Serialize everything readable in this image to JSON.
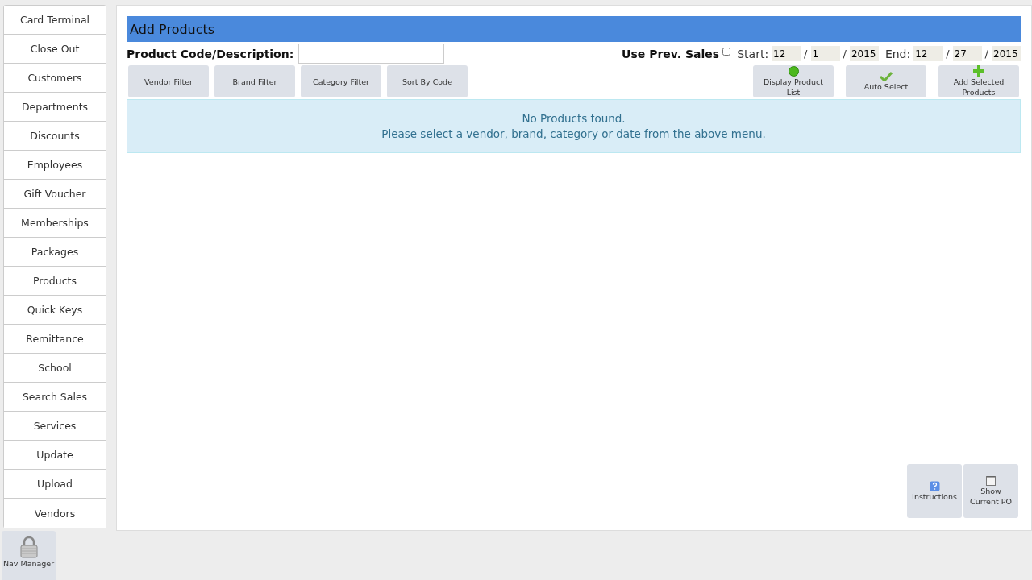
{
  "sidebar": {
    "items": [
      {
        "label": "Card Terminal",
        "selected": false
      },
      {
        "label": "Close Out",
        "selected": false
      },
      {
        "label": "Customers",
        "selected": false
      },
      {
        "label": "Departments",
        "selected": false
      },
      {
        "label": "Discounts",
        "selected": false
      },
      {
        "label": "Employees",
        "selected": false
      },
      {
        "label": "Gift Voucher",
        "selected": false
      },
      {
        "label": "Memberships",
        "selected": false
      },
      {
        "label": "Packages",
        "selected": false
      },
      {
        "label": "Products",
        "selected": false
      },
      {
        "label": "Quick Keys",
        "selected": false
      },
      {
        "label": "Remittance",
        "selected": false
      },
      {
        "label": "School",
        "selected": false
      },
      {
        "label": "Search Sales",
        "selected": false
      },
      {
        "label": "Services",
        "selected": false
      },
      {
        "label": "Update",
        "selected": false
      },
      {
        "label": "Upload",
        "selected": false
      },
      {
        "label": "Vendors",
        "selected": false
      }
    ]
  },
  "nav_manager": {
    "label": "Nav Manager",
    "kind": "lock"
  },
  "panel": {
    "title": "Add Products",
    "search": {
      "label": "Product Code/Description:"
    },
    "prev_sales": {
      "label": "Use Prev. Sales",
      "checked": false
    },
    "start": {
      "label": "Start:",
      "fields": [
        "12",
        "1",
        "2015"
      ]
    },
    "end": {
      "label": "End:",
      "fields": [
        "12",
        "27",
        "2015"
      ]
    },
    "separator": "/",
    "filters": [
      {
        "label": "Vendor Filter"
      },
      {
        "label": "Brand Filter"
      },
      {
        "label": "Category Filter"
      },
      {
        "label": "Sort By Code"
      }
    ],
    "actions": [
      {
        "label": "Display Product List",
        "kind": "circle"
      },
      {
        "label": "Auto Select",
        "kind": "check"
      },
      {
        "label": "Add Selected Products",
        "kind": "plus"
      }
    ],
    "message": [
      "No Products found.",
      "Please select a vendor, brand, category or date from the above menu."
    ],
    "bottom_buttons": [
      {
        "label": "Instructions",
        "kind": "question"
      },
      {
        "label": "Show Current PO",
        "kind": "notepad"
      }
    ]
  }
}
